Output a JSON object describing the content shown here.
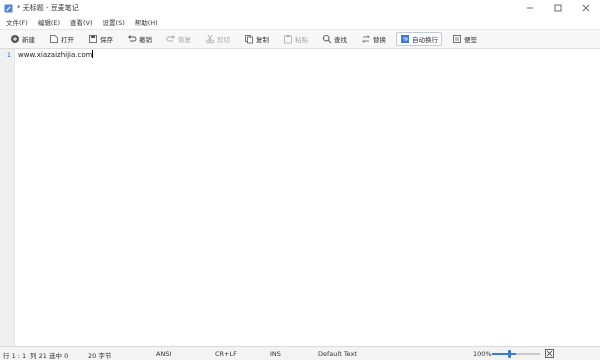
{
  "window": {
    "title": "* 无标题 - 豆麦笔记",
    "controls": [
      "minimize-icon",
      "maximize-icon",
      "close-icon"
    ]
  },
  "menu": {
    "items": [
      "文件(F)",
      "编辑(E)",
      "查看(V)",
      "设置(S)",
      "帮助(H)"
    ]
  },
  "toolbar": {
    "buttons": [
      {
        "label": "新建",
        "icon": "new-icon",
        "enabled": true
      },
      {
        "label": "打开",
        "icon": "open-icon",
        "enabled": true
      },
      {
        "label": "保存",
        "icon": "save-icon",
        "enabled": true
      },
      {
        "label": "撤销",
        "icon": "undo-icon",
        "enabled": true
      },
      {
        "label": "恢复",
        "icon": "redo-icon",
        "enabled": false
      },
      {
        "label": "剪切",
        "icon": "cut-icon",
        "enabled": false
      },
      {
        "label": "复制",
        "icon": "copy-icon",
        "enabled": true
      },
      {
        "label": "粘贴",
        "icon": "paste-icon",
        "enabled": false
      },
      {
        "label": "查找",
        "icon": "find-icon",
        "enabled": true
      },
      {
        "label": "替换",
        "icon": "replace-icon",
        "enabled": true
      },
      {
        "label": "自动换行",
        "icon": "wrap-icon",
        "enabled": true,
        "active": true
      },
      {
        "label": "便签",
        "icon": "note-icon",
        "enabled": true
      }
    ]
  },
  "editor": {
    "line_number": "1",
    "content": "www.xiazaizhijia.com"
  },
  "status": {
    "position": "行 1 : 1",
    "column": "列 21",
    "selection": "选中 0",
    "size": "20 字节",
    "encoding": "ANSI",
    "line_ending": "CR+LF",
    "mode": "INS",
    "syntax": "Default Text",
    "zoom": "100%",
    "zoom_level": 0.5
  },
  "colors": {
    "accent": "#3b7bd4",
    "line_number": "#2b5fb3"
  }
}
